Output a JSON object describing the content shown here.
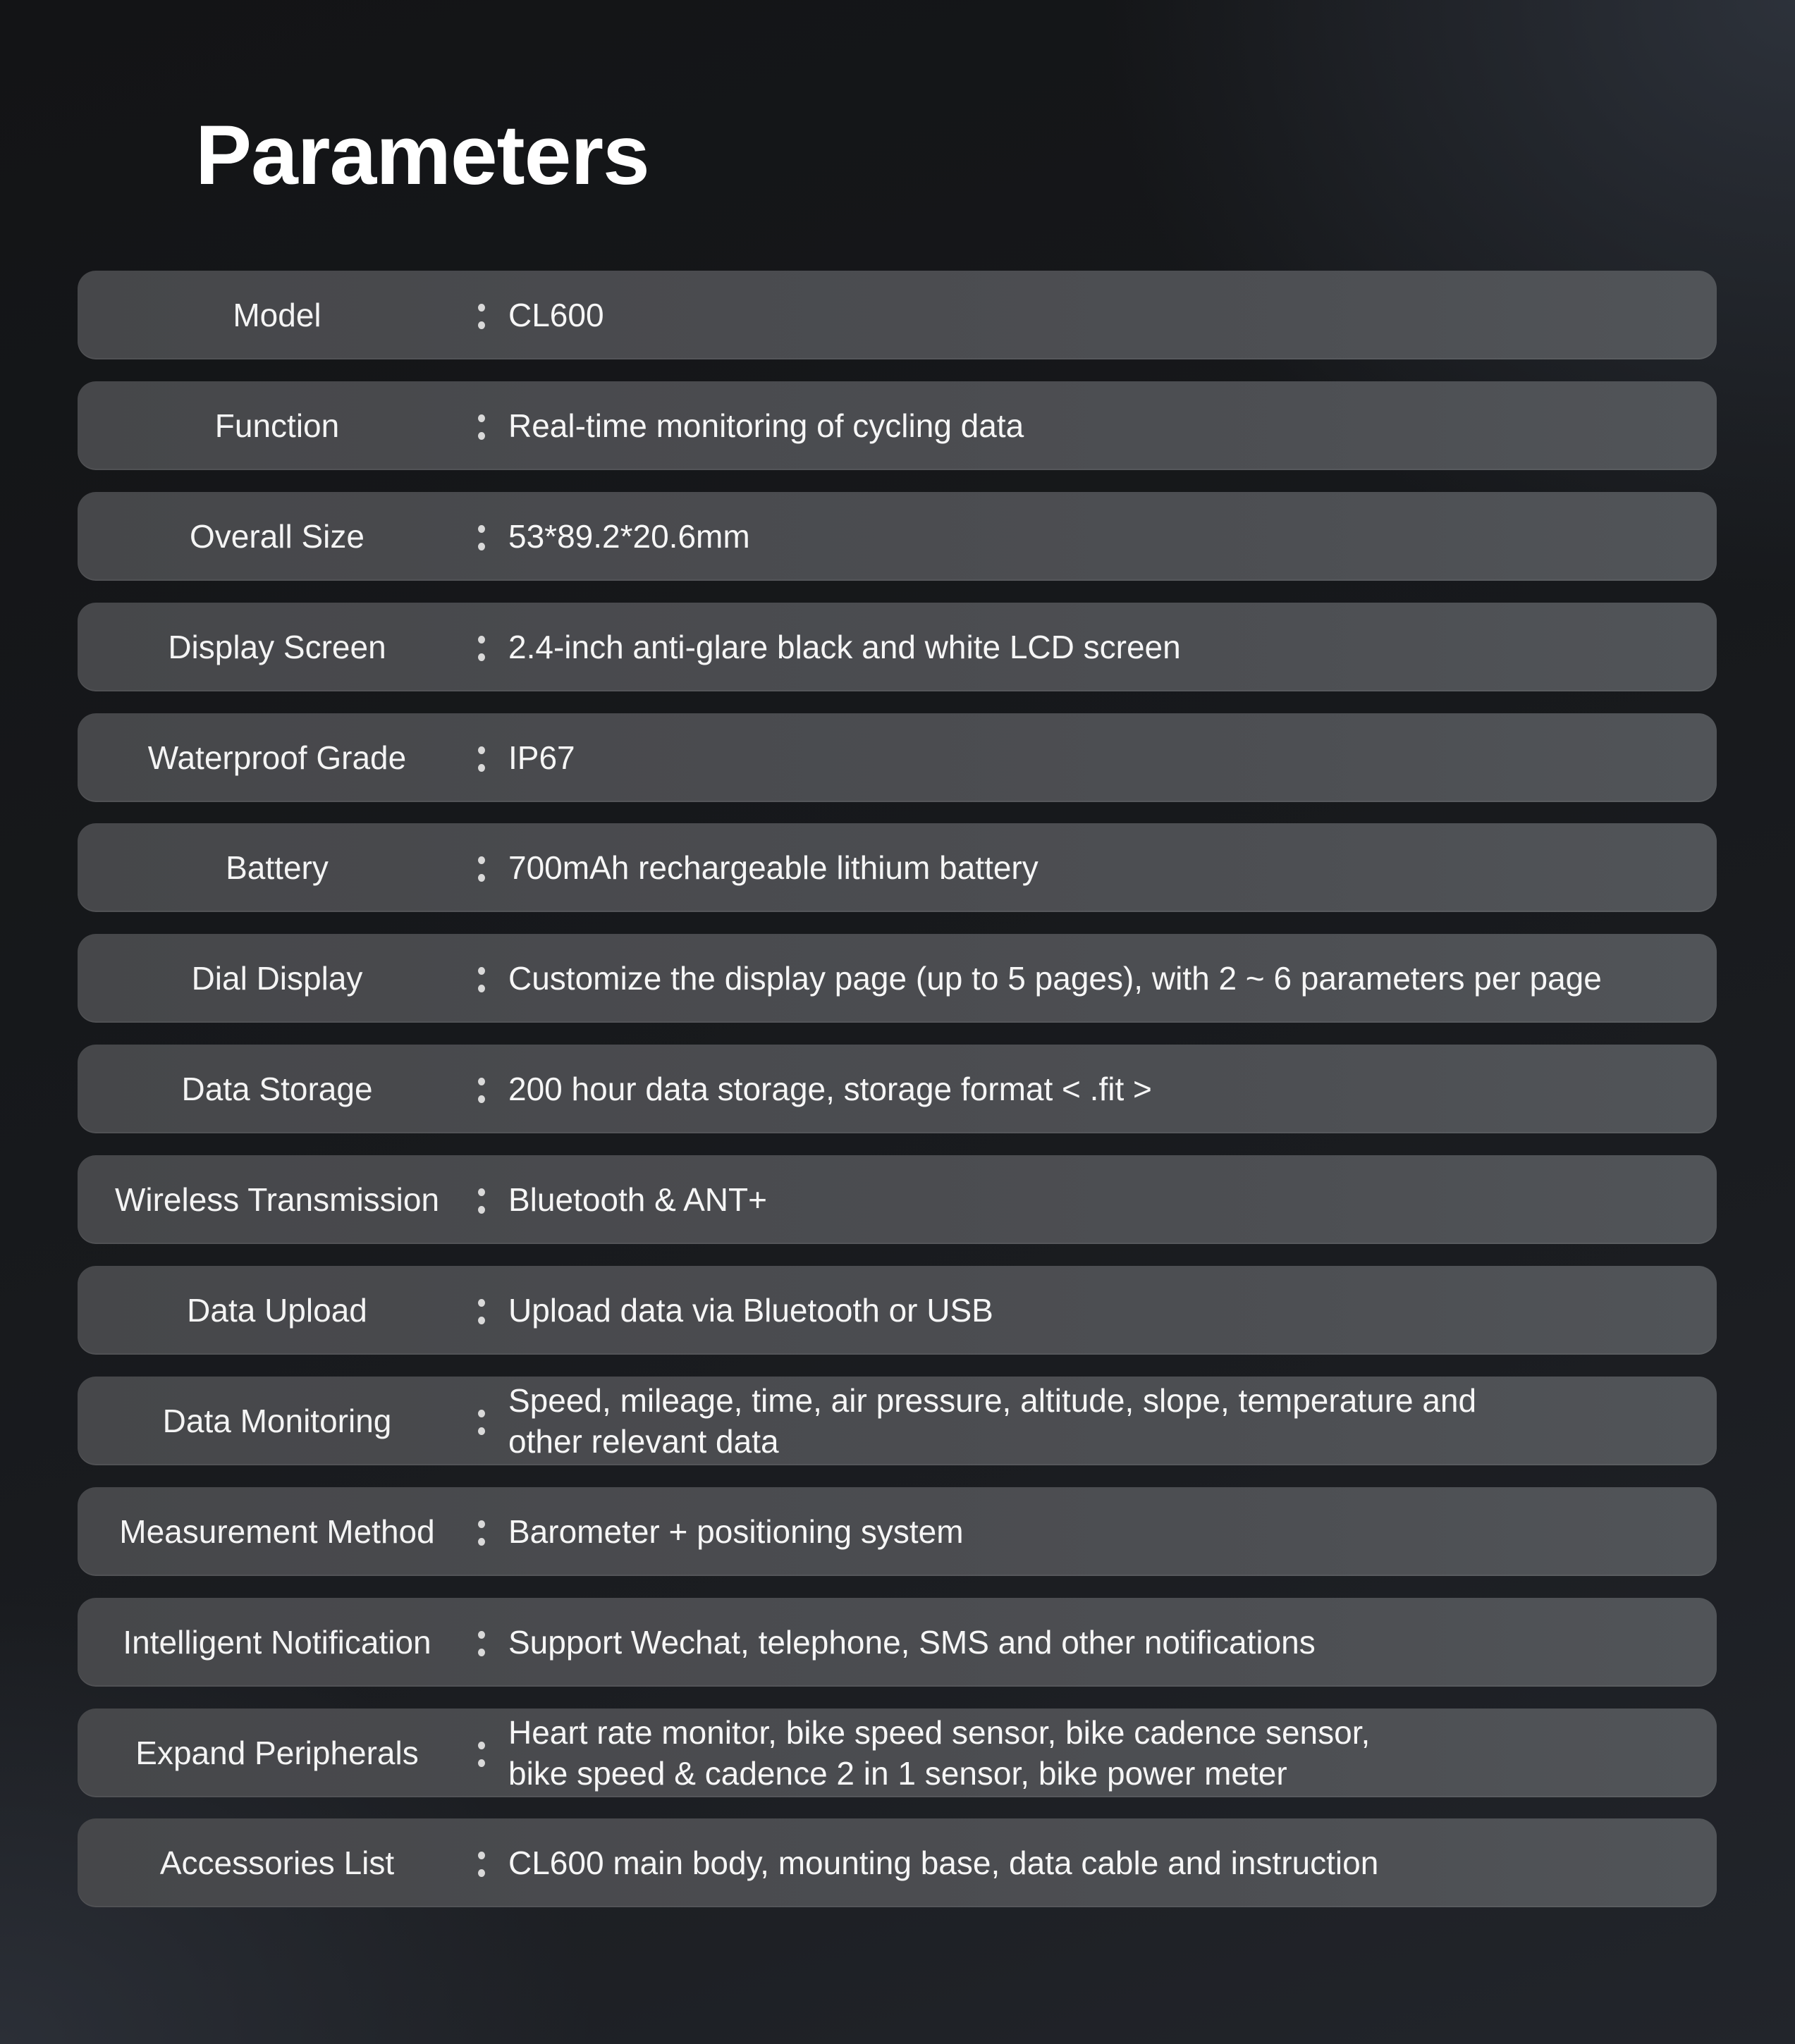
{
  "page": {
    "title": "Parameters"
  },
  "parameters": [
    {
      "label": "Model",
      "value": "CL600"
    },
    {
      "label": "Function",
      "value": "Real-time monitoring of cycling data"
    },
    {
      "label": "Overall Size",
      "value": "53*89.2*20.6mm"
    },
    {
      "label": "Display Screen",
      "value": "2.4-inch anti-glare black and white LCD screen"
    },
    {
      "label": "Waterproof Grade",
      "value": "IP67"
    },
    {
      "label": "Battery",
      "value": "700mAh rechargeable lithium battery"
    },
    {
      "label": "Dial Display",
      "value": "Customize the display page (up to 5 pages), with 2 ~ 6 parameters per page"
    },
    {
      "label": "Data Storage",
      "value": "200 hour data storage, storage format < .fit >"
    },
    {
      "label": "Wireless Transmission",
      "value": "Bluetooth & ANT+"
    },
    {
      "label": "Data Upload",
      "value": "Upload data via Bluetooth or USB"
    },
    {
      "label": "Data Monitoring",
      "value": "Speed, mileage, time, air pressure, altitude, slope, temperature and\nother relevant data"
    },
    {
      "label": "Measurement Method",
      "value": "Barometer + positioning system"
    },
    {
      "label": "Intelligent Notification",
      "value": "Support Wechat, telephone, SMS and other notifications"
    },
    {
      "label": "Expand Peripherals",
      "value": "Heart rate monitor, bike speed sensor, bike cadence sensor,\nbike speed & cadence 2 in 1 sensor, bike power meter"
    },
    {
      "label": "Accessories List",
      "value": "CL600 main body, mounting base, data cable and instruction"
    }
  ],
  "colors": {
    "background_dark": "#141517",
    "background_light": "#2a2e36",
    "row": "#4a4c50",
    "text": "#ffffff",
    "colon": "#d9d9d9"
  }
}
